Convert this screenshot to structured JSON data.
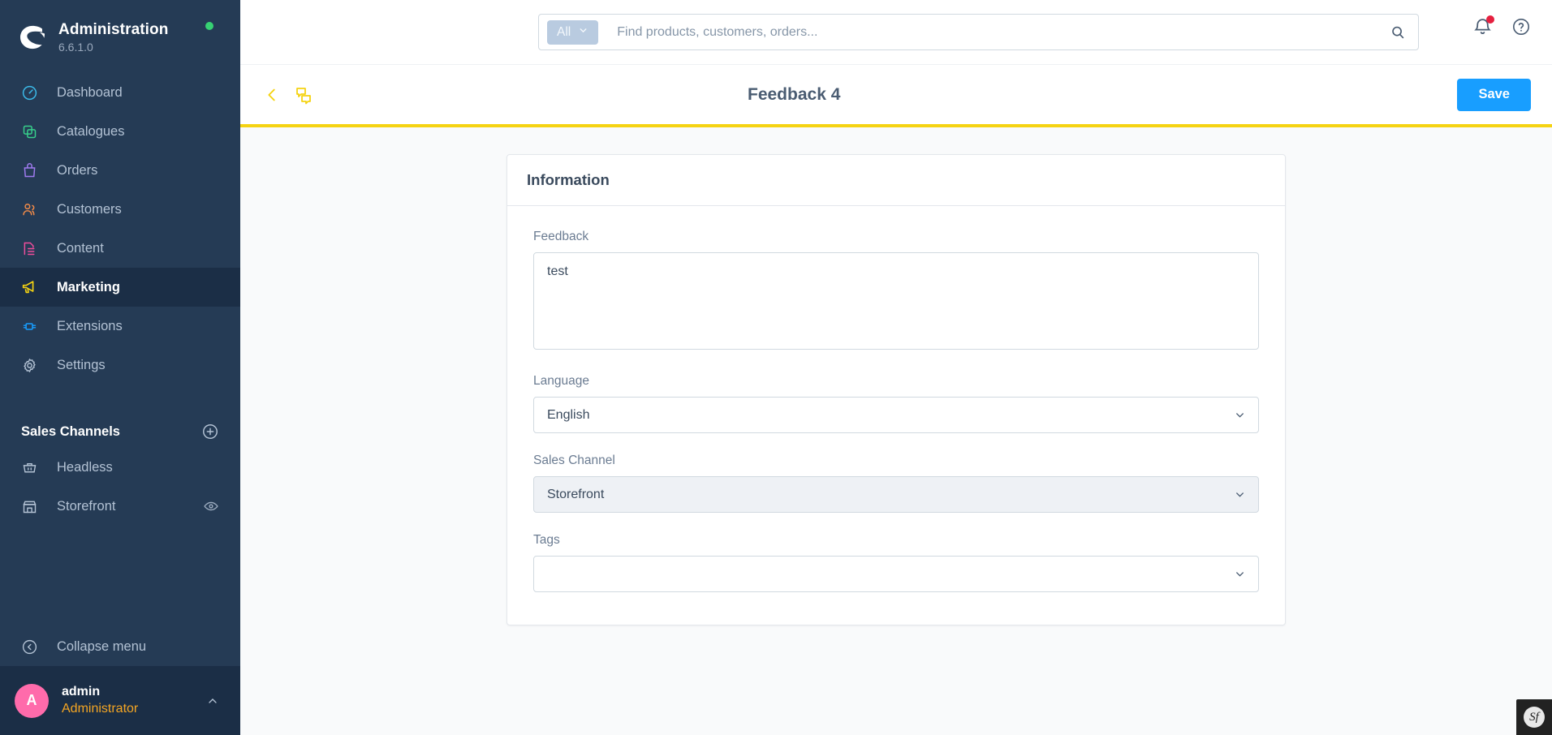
{
  "sidebar": {
    "brand": {
      "title": "Administration",
      "version": "6.6.1.0",
      "status_icon": "status-dot-online"
    },
    "nav": [
      {
        "label": "Dashboard",
        "icon": "dashboard-icon",
        "color": "#3bb9e8",
        "active": false
      },
      {
        "label": "Catalogues",
        "icon": "catalogues-icon",
        "color": "#37cf8b",
        "active": false
      },
      {
        "label": "Orders",
        "icon": "orders-icon",
        "color": "#a07bf0",
        "active": false
      },
      {
        "label": "Customers",
        "icon": "customers-icon",
        "color": "#f28b49",
        "active": false
      },
      {
        "label": "Content",
        "icon": "content-icon",
        "color": "#ef4d9c",
        "active": false
      },
      {
        "label": "Marketing",
        "icon": "marketing-icon",
        "color": "#f5d312",
        "active": true
      },
      {
        "label": "Extensions",
        "icon": "extensions-icon",
        "color": "#189eff",
        "active": false
      },
      {
        "label": "Settings",
        "icon": "settings-icon",
        "color": "#b3c2d4",
        "active": false
      }
    ],
    "sales_channels": {
      "title": "Sales Channels",
      "add_icon": "plus-circle-icon",
      "items": [
        {
          "label": "Headless",
          "icon": "basket-icon",
          "has_eye": false
        },
        {
          "label": "Storefront",
          "icon": "shop-icon",
          "has_eye": true,
          "eye_icon": "eye-icon"
        }
      ]
    },
    "collapse": {
      "label": "Collapse menu",
      "icon": "collapse-left-icon"
    },
    "user": {
      "initial": "A",
      "name": "admin",
      "role": "Administrator",
      "caret_icon": "caret-up-icon"
    }
  },
  "topbar": {
    "scope": {
      "label": "All",
      "chevron_icon": "chevron-down-icon"
    },
    "search": {
      "placeholder": "Find products, customers, orders...",
      "value": "",
      "icon": "search-icon"
    },
    "notifications": {
      "icon": "bell-icon",
      "has_badge": true,
      "badge_color": "#e5203f"
    },
    "help": {
      "icon": "help-circle-icon"
    }
  },
  "pagehead": {
    "back_icon": "chevron-left-icon",
    "feedback_icon": "feedback-bubbles-icon",
    "title": "Feedback 4",
    "save_label": "Save",
    "save_color": "#189eff",
    "accent_color": "#f5d312"
  },
  "card": {
    "title": "Information",
    "fields": {
      "feedback": {
        "label": "Feedback",
        "value": "test",
        "type": "textarea"
      },
      "language": {
        "label": "Language",
        "value": "English",
        "type": "select",
        "disabled": false
      },
      "sales_channel": {
        "label": "Sales Channel",
        "value": "Storefront",
        "type": "select",
        "disabled": true
      },
      "tags": {
        "label": "Tags",
        "value": "",
        "type": "select",
        "disabled": false
      }
    }
  },
  "debug_toolbar": {
    "label": "Sf",
    "name": "symfony-profiler-toolbar"
  }
}
